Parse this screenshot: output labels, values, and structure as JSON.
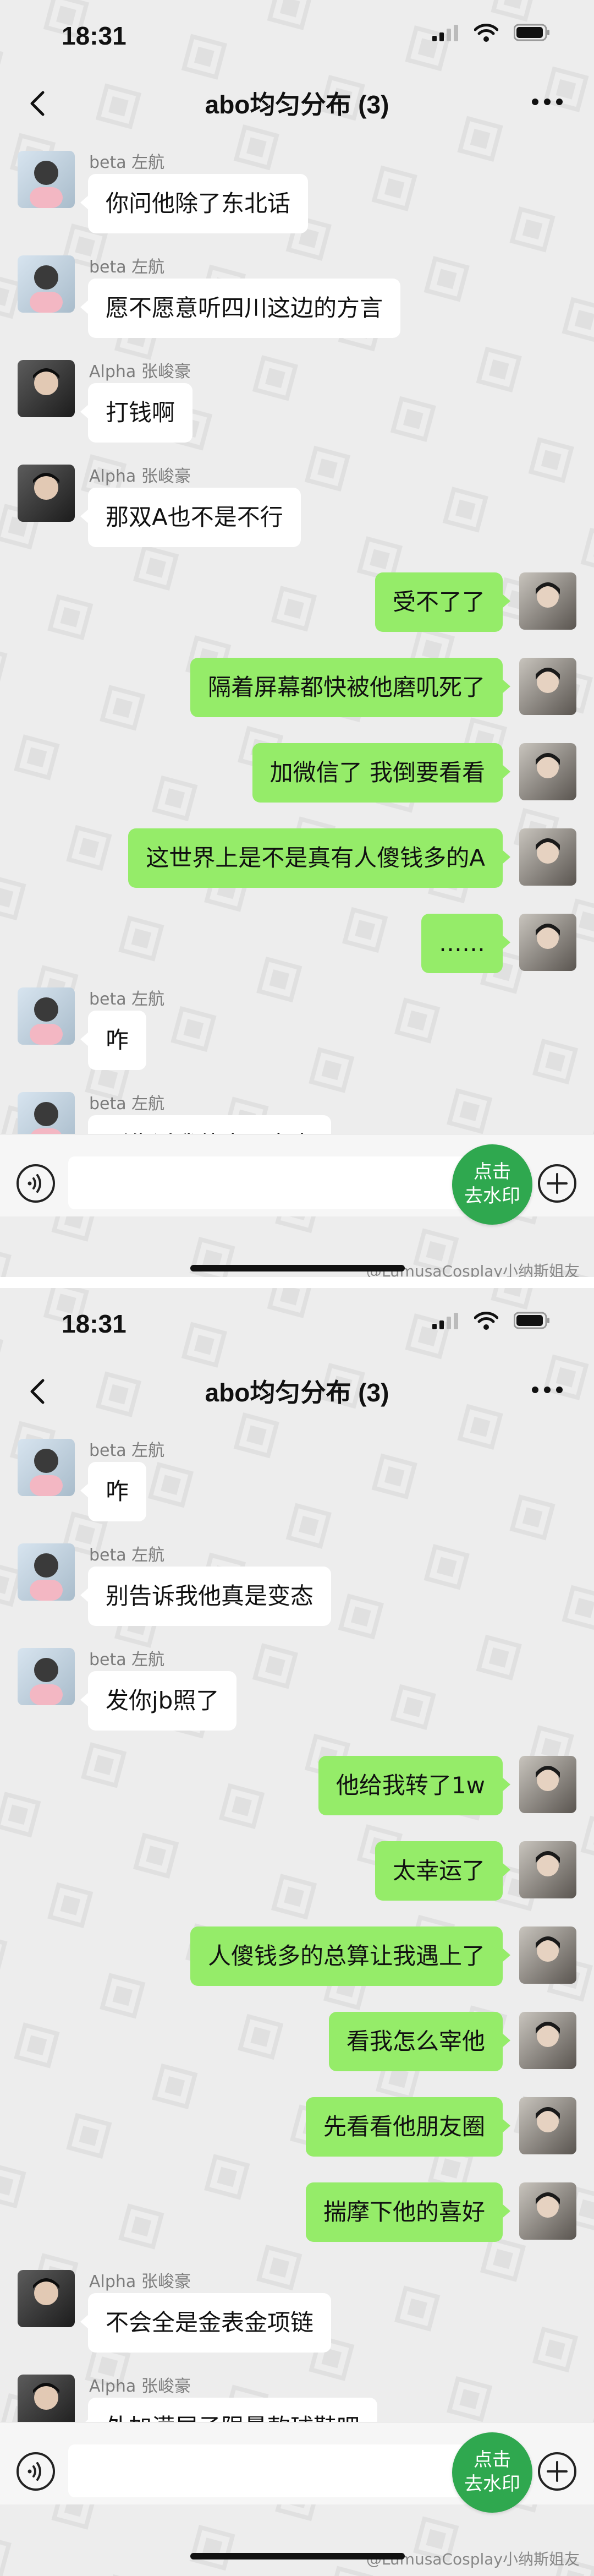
{
  "status_bar": {
    "time": "18:31"
  },
  "chat_title": "abo均匀分布 (3)",
  "watermark_button": {
    "line1": "点击",
    "line2": "去水印"
  },
  "credit": "@LumusaCosplay小纳斯姐友",
  "colors": {
    "background": "#ededed",
    "bubble_self": "#95ec69",
    "bubble_other": "#ffffff",
    "watermark_button": "#2fa84f"
  },
  "screen1": {
    "messages": [
      {
        "side": "left",
        "sender": "beta 左航",
        "text": "你问他除了东北话",
        "avatar": "avatar-zuohang"
      },
      {
        "side": "left",
        "sender": "beta 左航",
        "text": "愿不愿意听四川这边的方言",
        "avatar": "avatar-zuohang"
      },
      {
        "side": "left",
        "sender": "Alpha 张峻豪",
        "text": "打钱啊",
        "avatar": "avatar-zhangjunhao"
      },
      {
        "side": "left",
        "sender": "Alpha 张峻豪",
        "text": "那双A也不是不行",
        "avatar": "avatar-zhangjunhao"
      },
      {
        "side": "right",
        "text": "受不了了",
        "avatar": "avatar-self"
      },
      {
        "side": "right",
        "text": "隔着屏幕都快被他磨叽死了",
        "avatar": "avatar-self"
      },
      {
        "side": "right",
        "text": "加微信了 我倒要看看",
        "avatar": "avatar-self"
      },
      {
        "side": "right",
        "text": "这世界上是不是真有人傻钱多的A",
        "avatar": "avatar-self"
      },
      {
        "side": "right",
        "text": "……",
        "avatar": "avatar-self"
      },
      {
        "side": "left",
        "sender": "beta 左航",
        "text": "咋",
        "avatar": "avatar-zuohang"
      },
      {
        "side": "left",
        "sender": "beta 左航",
        "text": "别告诉我他真是变态",
        "avatar": "avatar-zuohang"
      }
    ]
  },
  "screen2": {
    "messages": [
      {
        "side": "left",
        "sender": "beta 左航",
        "text": "咋",
        "avatar": "avatar-zuohang"
      },
      {
        "side": "left",
        "sender": "beta 左航",
        "text": "别告诉我他真是变态",
        "avatar": "avatar-zuohang"
      },
      {
        "side": "left",
        "sender": "beta 左航",
        "text": "发你jb照了",
        "avatar": "avatar-zuohang"
      },
      {
        "side": "right",
        "text": "他给我转了1w",
        "avatar": "avatar-self"
      },
      {
        "side": "right",
        "text": "太幸运了",
        "avatar": "avatar-self"
      },
      {
        "side": "right",
        "text": "人傻钱多的总算让我遇上了",
        "avatar": "avatar-self"
      },
      {
        "side": "right",
        "text": "看我怎么宰他",
        "avatar": "avatar-self"
      },
      {
        "side": "right",
        "text": "先看看他朋友圈",
        "avatar": "avatar-self"
      },
      {
        "side": "right",
        "text": "揣摩下他的喜好",
        "avatar": "avatar-self"
      },
      {
        "side": "left",
        "sender": "Alpha 张峻豪",
        "text": "不会全是金表金项链",
        "avatar": "avatar-zhangjunhao"
      },
      {
        "side": "left",
        "sender": "Alpha 张峻豪",
        "text": "外加满屋子限量款球鞋吧",
        "avatar": "avatar-zhangjunhao"
      }
    ]
  }
}
